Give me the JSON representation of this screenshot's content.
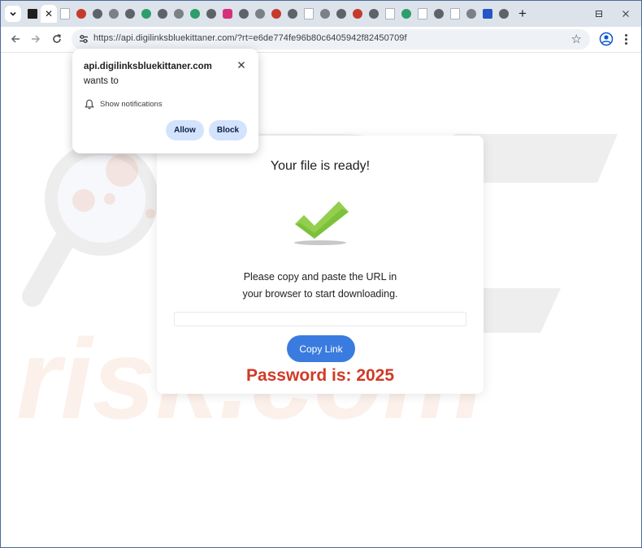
{
  "browser": {
    "url": "https://api.digilinksbluekittaner.com/?rt=e6de774fe96b80c6405942f82450709f",
    "tab_close_glyph": "✕",
    "new_tab_glyph": "+",
    "tab_menu_glyph": "⌄",
    "window_controls": {
      "minimize": "—",
      "maximize": "☐",
      "close": "✕"
    },
    "nav": {
      "back": "←",
      "forward": "→",
      "reload": "↻",
      "bookmark": "☆"
    },
    "icons": [
      "chevron-down-icon",
      "tab-strip-icon",
      "close-icon",
      "plus-icon",
      "minimize-icon",
      "maximize-icon",
      "window-close-icon",
      "back-arrow-icon",
      "forward-arrow-icon",
      "reload-icon",
      "site-info-icon",
      "star-icon",
      "profile-icon",
      "kebab-menu-icon"
    ]
  },
  "permission_prompt": {
    "host": "api.digilinksbluekittaner.com",
    "wants_to": "wants to",
    "permission": "Show notifications",
    "allow_label": "Allow",
    "block_label": "Block",
    "close_glyph": "✕",
    "icons": [
      "bell-icon",
      "close-icon"
    ]
  },
  "page": {
    "title": "Your file is ready!",
    "instructions_line1": "Please copy and paste the URL in",
    "instructions_line2": "your browser to start downloading.",
    "link_field_value": "",
    "copy_button_label": "Copy Link",
    "password_text": "Password is: 2025",
    "icons": [
      "checkmark-icon"
    ],
    "colors": {
      "accent": "#3a7be0",
      "password": "#d03a26",
      "check_green": "#7cc13a"
    }
  }
}
